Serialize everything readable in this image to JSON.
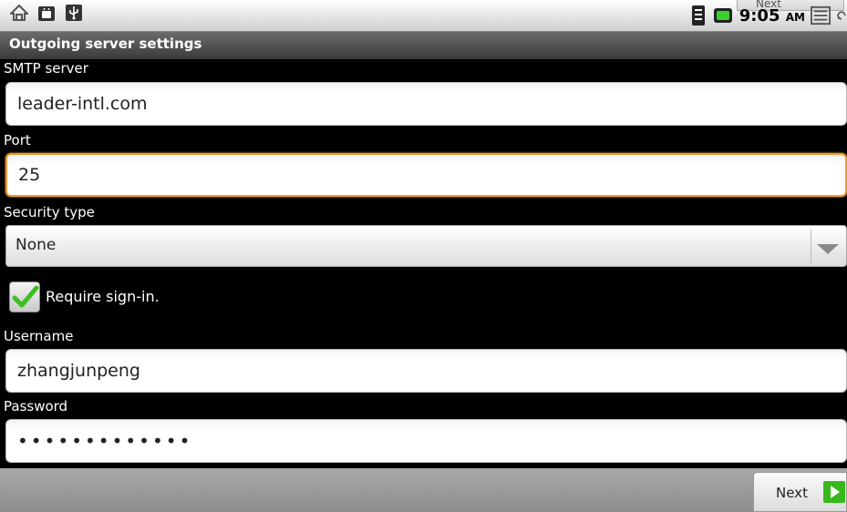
{
  "status_bar": {
    "time": "9:05",
    "ampm": "AM",
    "peek_button": "Next"
  },
  "title": "Outgoing server settings",
  "smtp": {
    "label": "SMTP server",
    "value": "leader-intl.com"
  },
  "port": {
    "label": "Port",
    "value": "25"
  },
  "security": {
    "label": "Security type",
    "value": "None"
  },
  "require_signin": {
    "label": "Require sign-in.",
    "checked": true
  },
  "username": {
    "label": "Username",
    "value": "zhangjunpeng"
  },
  "password": {
    "label": "Password",
    "value": "•••••••••••••"
  },
  "next_button": {
    "label": "Next"
  },
  "colors": {
    "focus": "#f19a2b",
    "check": "#3cbf21",
    "next_icon": "#38b81c"
  },
  "icons": [
    "home-icon",
    "android-icon",
    "usb-icon",
    "signal-icon",
    "battery-icon",
    "menu-icon",
    "back-icon",
    "dropdown-arrow-icon",
    "checkmark-icon",
    "next-arrow-icon"
  ]
}
